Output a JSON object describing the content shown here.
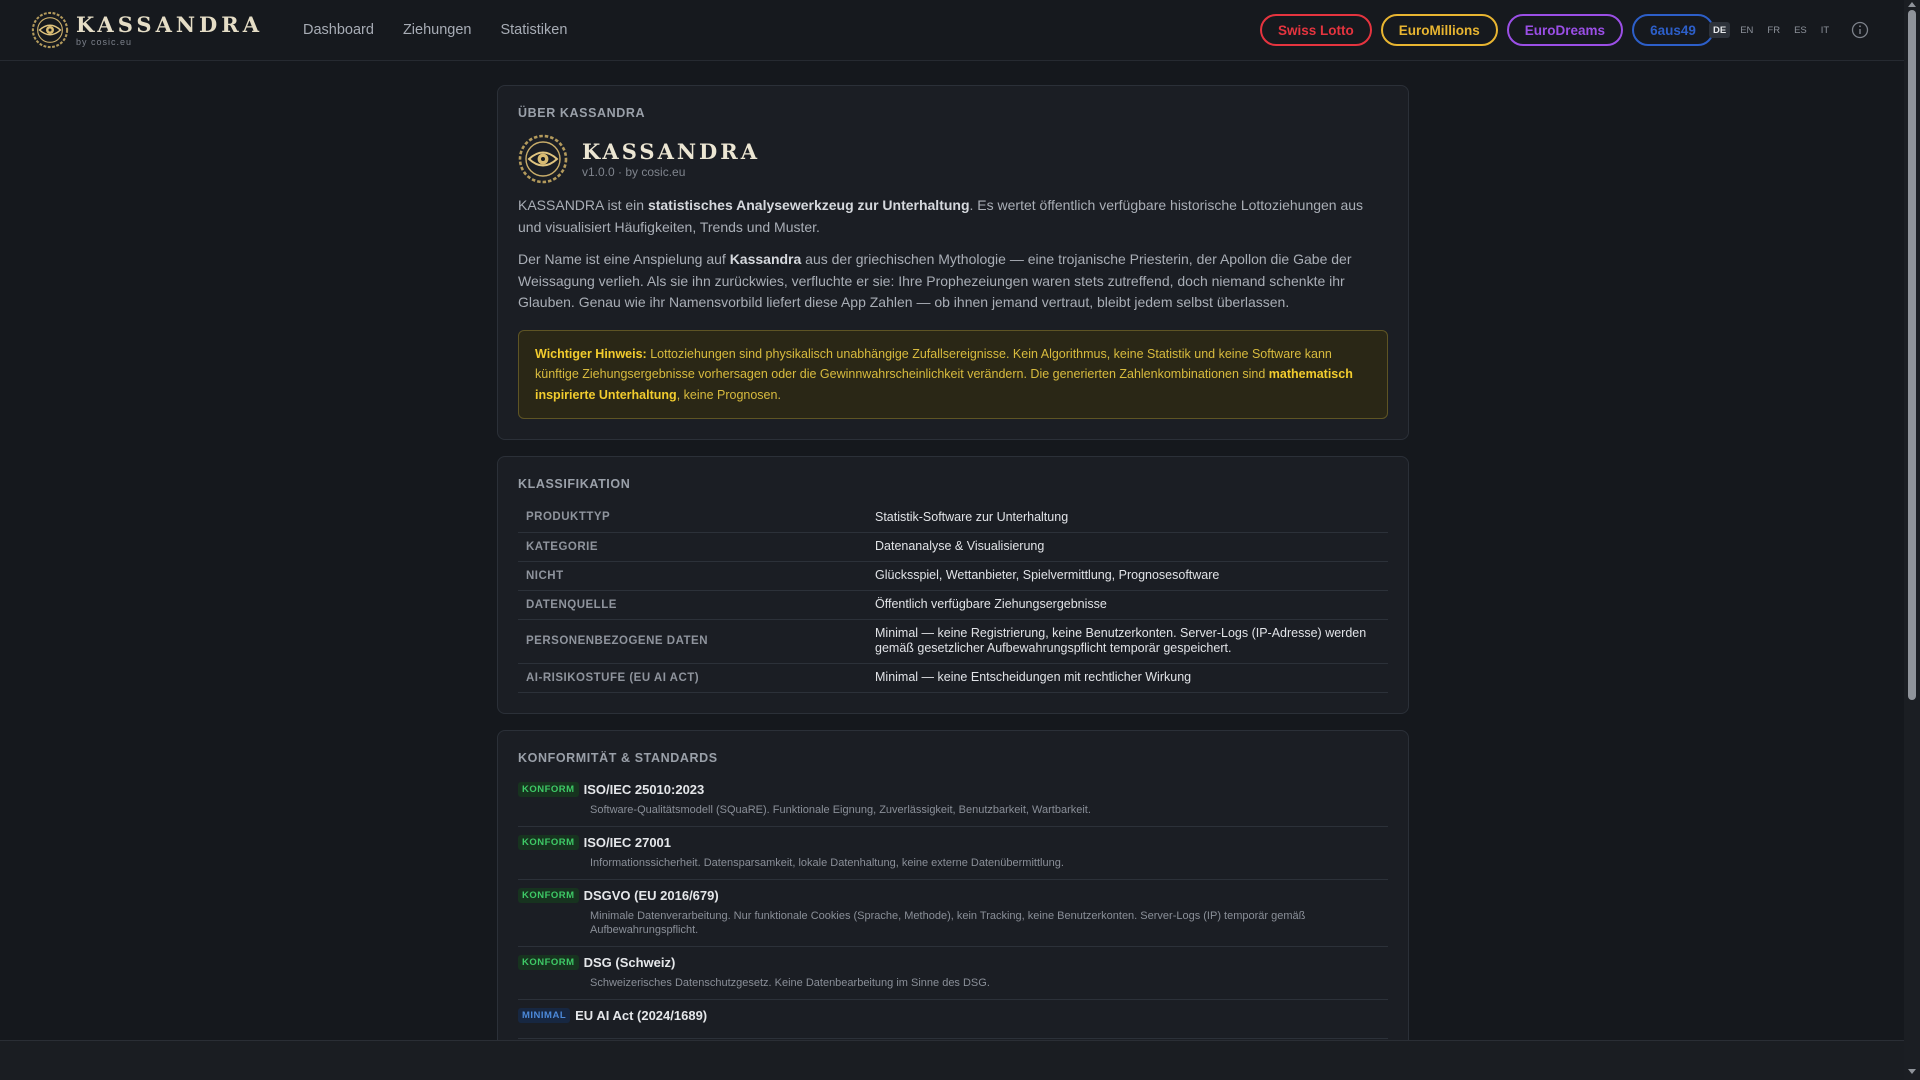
{
  "brand": {
    "name": "KASSANDRA",
    "sub": "by cosic.eu"
  },
  "nav": {
    "links": [
      "Dashboard",
      "Ziehungen",
      "Statistiken"
    ]
  },
  "games": [
    {
      "label": "Swiss Lotto",
      "color": "#e5343f"
    },
    {
      "label": "EuroMillions",
      "color": "#e8b531"
    },
    {
      "label": "EuroDreams",
      "color": "#9b4fe6"
    },
    {
      "label": "6aus49",
      "color": "#2d5fc9"
    }
  ],
  "languages": [
    "DE",
    "EN",
    "FR",
    "ES",
    "IT"
  ],
  "active_language": "DE",
  "about": {
    "section_title": "ÜBER KASSANDRA",
    "app_name": "KASSANDRA",
    "version": "v1.0.0 · by cosic.eu",
    "p1_pre": "KASSANDRA ist ein ",
    "p1_bold": "statistisches Analysewerkzeug zur Unterhaltung",
    "p1_post": ". Es wertet öffentlich verfügbare historische Lottoziehungen aus und visualisiert Häufigkeiten, Trends und Muster.",
    "p2_pre": "Der Name ist eine Anspielung auf ",
    "p2_bold": "Kassandra",
    "p2_post": " aus der griechischen Mythologie — eine trojanische Priesterin, der Apollon die Gabe der Weissagung verlieh. Als sie ihn zurückwies, verfluchte er sie: Ihre Prophezeiungen waren stets zutreffend, doch niemand schenkte ihr Glauben. Genau wie ihr Namensvorbild liefert diese App Zahlen — ob ihnen jemand vertraut, bleibt jedem selbst überlassen.",
    "notice_label": "Wichtiger Hinweis:",
    "notice_text": " Lottoziehungen sind physikalisch unabhängige Zufallsereignisse. Kein Algorithmus, keine Statistik und keine Software kann künftige Ziehungsergebnisse vorhersagen oder die Gewinnwahrscheinlichkeit verändern. Die generierten Zahlenkombinationen sind ",
    "notice_bold2": "mathematisch inspirierte Unterhaltung",
    "notice_end": ", keine Prognosen."
  },
  "classification": {
    "section_title": "KLASSIFIKATION",
    "rows": [
      {
        "key": "PRODUKTTYP",
        "value": "Statistik-Software zur Unterhaltung"
      },
      {
        "key": "KATEGORIE",
        "value": "Datenanalyse & Visualisierung"
      },
      {
        "key": "NICHT",
        "value": "Glücksspiel, Wettanbieter, Spielvermittlung, Prognosesoftware"
      },
      {
        "key": "DATENQUELLE",
        "value": "Öffentlich verfügbare Ziehungsergebnisse"
      },
      {
        "key": "PERSONENBEZOGENE DATEN",
        "value": "Minimal — keine Registrierung, keine Benutzerkonten. Server-Logs (IP-Adresse) werden gemäß gesetzlicher Aufbewahrungspflicht temporär gespeichert."
      },
      {
        "key": "AI-RISIKOSTUFE (EU AI ACT)",
        "value": "Minimal — keine Entscheidungen mit rechtlicher Wirkung"
      }
    ]
  },
  "conformity": {
    "section_title": "KONFORMITÄT & STANDARDS",
    "items": [
      {
        "badge": "KONFORM",
        "kind": "ok",
        "name": "ISO/IEC 25010:2023",
        "desc": "Software-Qualitätsmodell (SQuaRE). Funktionale Eignung, Zuverlässigkeit, Benutzbarkeit, Wartbarkeit."
      },
      {
        "badge": "KONFORM",
        "kind": "ok",
        "name": "ISO/IEC 27001",
        "desc": "Informationssicherheit. Datensparsamkeit, lokale Datenhaltung, keine externe Datenübermittlung."
      },
      {
        "badge": "KONFORM",
        "kind": "ok",
        "name": "DSGVO (EU 2016/679)",
        "desc": "Minimale Datenverarbeitung. Nur funktionale Cookies (Sprache, Methode), kein Tracking, keine Benutzerkonten. Server-Logs (IP) temporär gemäß Aufbewahrungspflicht."
      },
      {
        "badge": "KONFORM",
        "kind": "ok",
        "name": "DSG (Schweiz)",
        "desc": "Schweizerisches Datenschutzgesetz. Keine Datenbearbeitung im Sinne des DSG."
      },
      {
        "badge": "MINIMAL",
        "kind": "min",
        "name": "EU AI Act (2024/1689)",
        "desc": ""
      }
    ]
  }
}
